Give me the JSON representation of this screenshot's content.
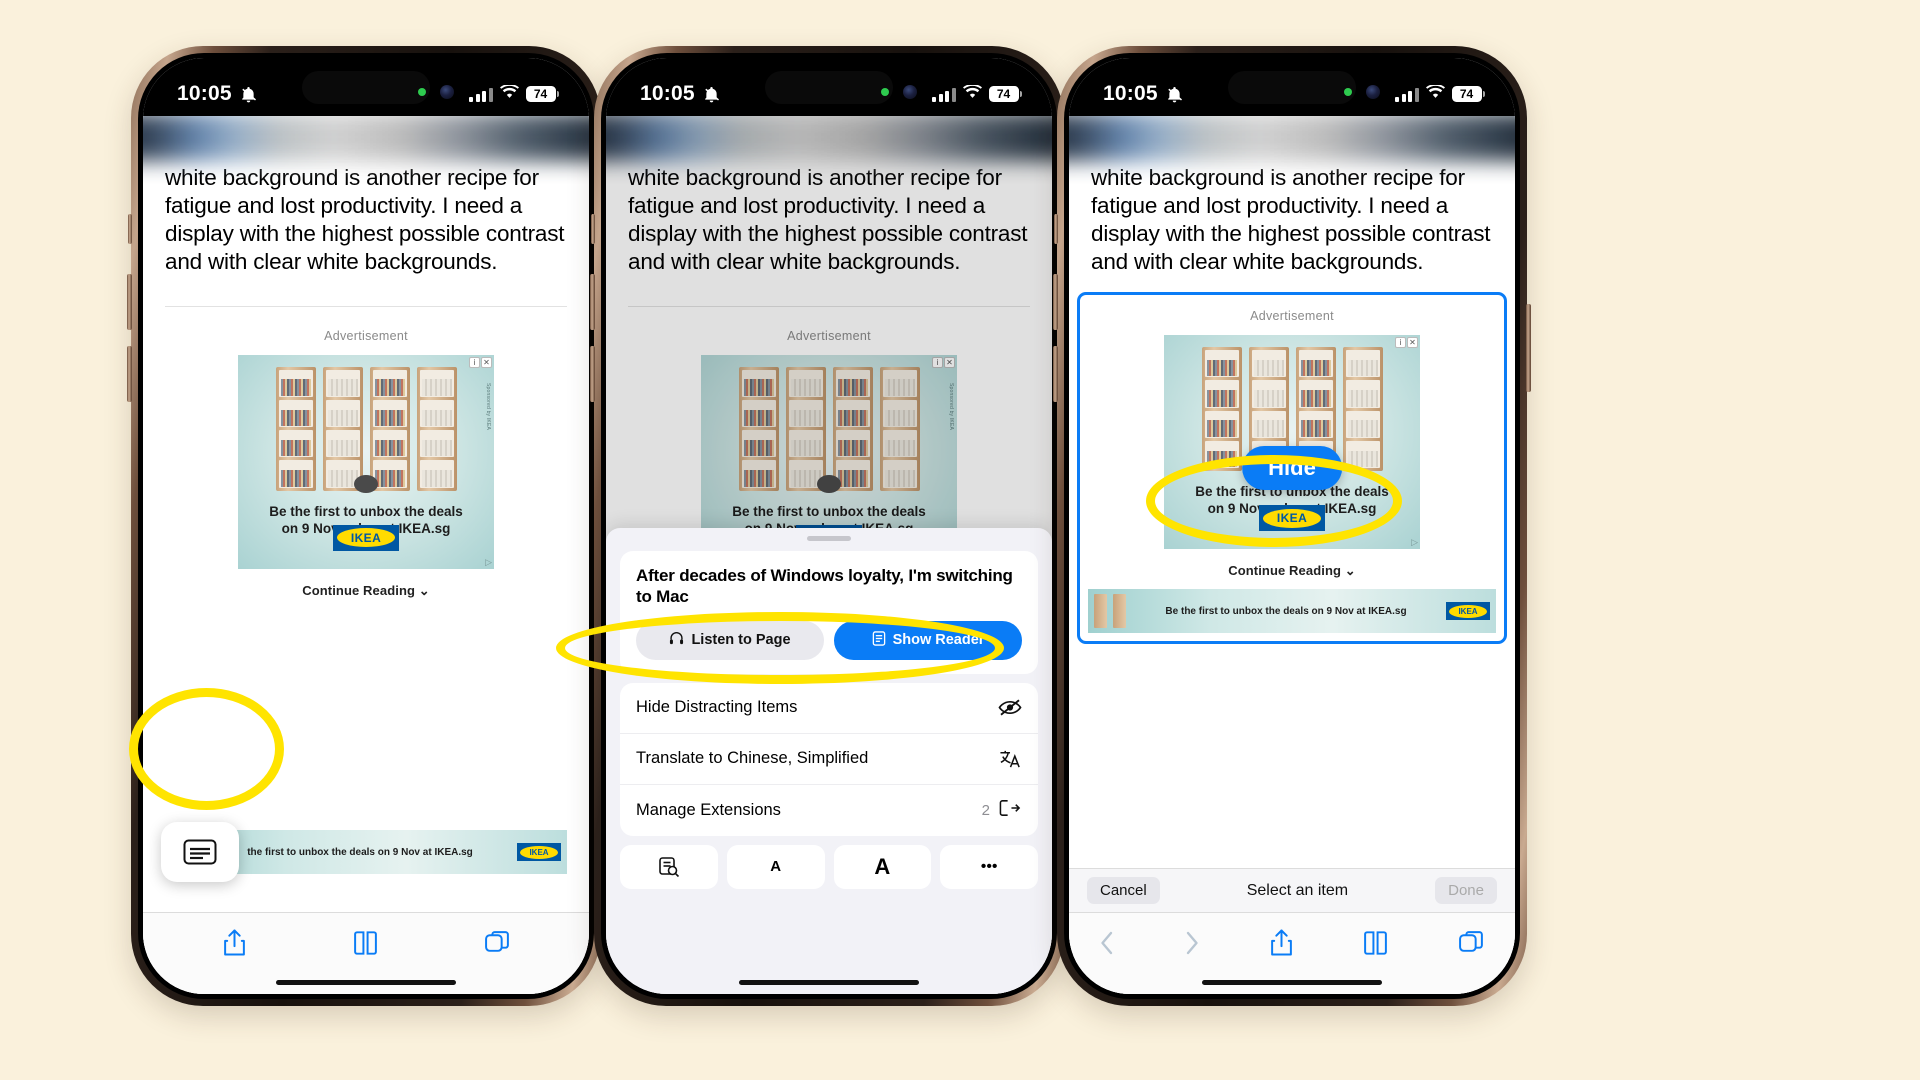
{
  "status_bar": {
    "time": "10:05",
    "mute_icon": "bell-slash-icon",
    "battery": "74"
  },
  "article": {
    "text": "white background is another recipe for fatigue and lost productivity. I need a display with the highest possible contrast and with clear white backgrounds."
  },
  "ad": {
    "label": "Advertisement",
    "line1": "Be the first to unbox the deals",
    "line2": "on 9 November at IKEA.sg",
    "brand": "IKEA",
    "continue_label": "Continue Reading",
    "banner_text": "the first to unbox the deals on 9 Nov at IKEA.sg",
    "banner_text_3": "Be the first to unbox the deals on 9 Nov at IKEA.sg",
    "side_text": "Sponsored by IKEA"
  },
  "phone1": {
    "reader_icon": "reader-mode-icon",
    "toolbar": [
      {
        "icon": "share-icon",
        "name": "share-button"
      },
      {
        "icon": "bookmarks-icon",
        "name": "bookmarks-button"
      },
      {
        "icon": "tabs-icon",
        "name": "tabs-button"
      }
    ]
  },
  "phone2": {
    "sheet_title": "After decades of Windows loyalty, I'm switching to Mac",
    "listen_label": "Listen to Page",
    "listen_icon": "headphones-icon",
    "reader_label": "Show Reader",
    "reader_icon": "reader-icon",
    "menu": [
      {
        "label": "Hide Distracting Items",
        "icon": "eye-slash-icon",
        "trailing": "",
        "highlighted": true
      },
      {
        "label": "Translate to Chinese, Simplified",
        "icon": "translate-icon",
        "trailing": ""
      },
      {
        "label": "Manage Extensions",
        "icon": "extensions-icon",
        "trailing": "2"
      }
    ],
    "tools": [
      {
        "label": "",
        "icon": "find-on-page-icon",
        "name": "find-on-page-button"
      },
      {
        "label": "A",
        "icon": "text-size-small-icon",
        "name": "decrease-text-size-button"
      },
      {
        "label": "A",
        "icon": "text-size-large-icon",
        "name": "increase-text-size-button"
      },
      {
        "label": "•••",
        "icon": "more-icon",
        "name": "more-options-button"
      }
    ]
  },
  "phone3": {
    "hide_label": "Hide",
    "cancel_label": "Cancel",
    "select_label": "Select an item",
    "done_label": "Done",
    "toolbar": [
      {
        "icon": "back-chevron-icon",
        "name": "back-button"
      },
      {
        "icon": "forward-chevron-icon",
        "name": "forward-button"
      },
      {
        "icon": "share-icon",
        "name": "share-button"
      },
      {
        "icon": "bookmarks-icon",
        "name": "bookmarks-button"
      },
      {
        "icon": "tabs-icon",
        "name": "tabs-button"
      }
    ]
  },
  "colors": {
    "background": "#faf1dc",
    "highlight": "#ffe400",
    "accent_blue": "#0a7cf6",
    "ikea_blue": "#0058a3",
    "ikea_yellow": "#ffdb00"
  }
}
